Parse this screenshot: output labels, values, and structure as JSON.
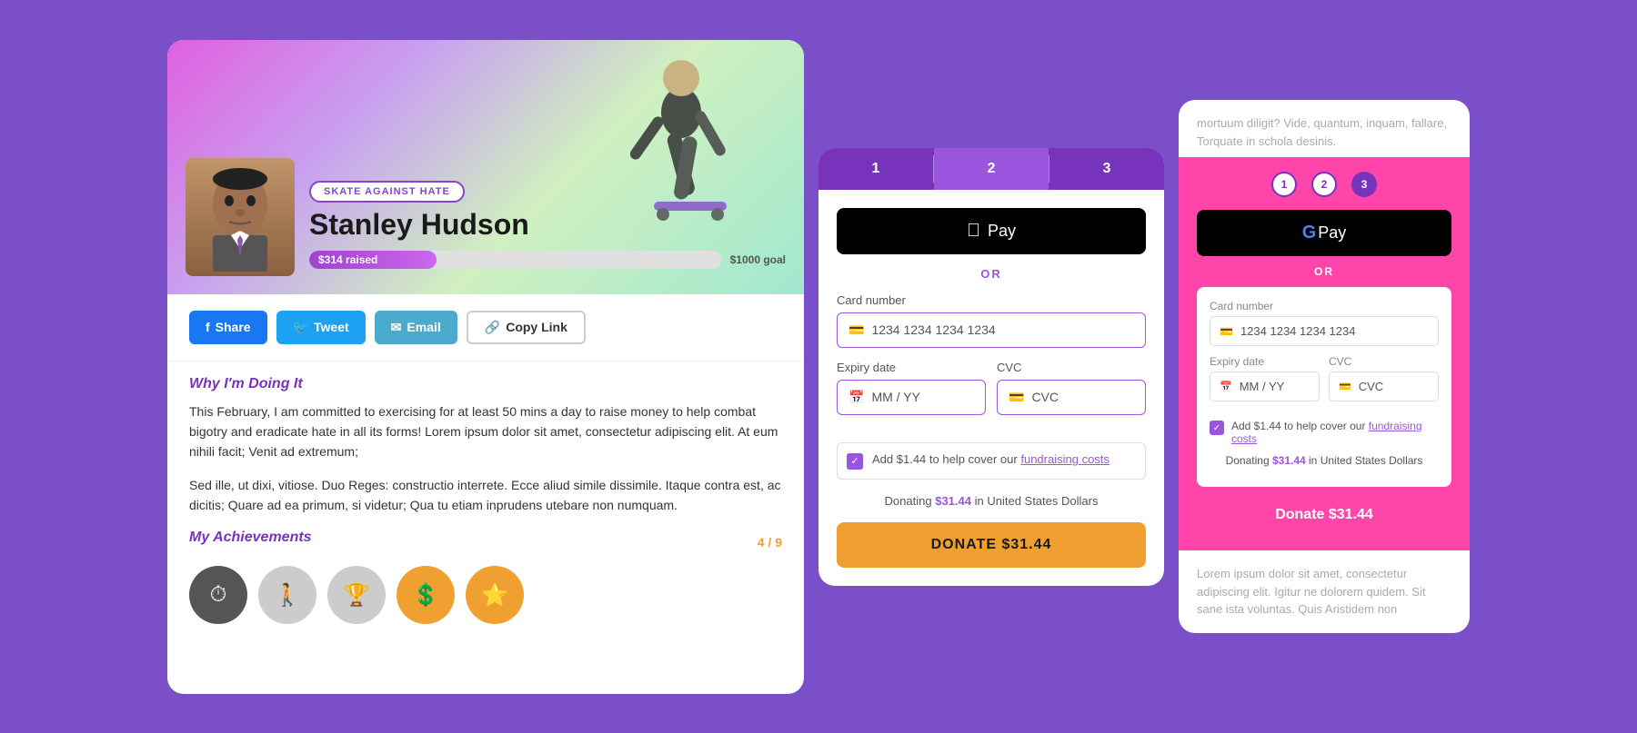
{
  "leftCard": {
    "campaignBadge": "Skate Against Hate",
    "profileName": "Stanley Hudson",
    "raisedAmount": "$314 raised",
    "goalAmount": "$1000 goal",
    "progressPercent": 31,
    "shareButtons": [
      {
        "label": "Share",
        "type": "facebook"
      },
      {
        "label": "Tweet",
        "type": "twitter"
      },
      {
        "label": "Email",
        "type": "email"
      },
      {
        "label": "Copy Link",
        "type": "copylink"
      }
    ],
    "whyTitle": "Why I'm Doing It",
    "whyText1": "This February, I am committed to exercising for at least 50 mins a day to raise money to help combat bigotry and eradicate hate in all its forms! Lorem ipsum dolor sit amet, consectetur adipiscing elit. At eum nihili facit; Venit ad extremum;",
    "whyText2": "Sed ille, ut dixi, vitiose. Duo Reges: constructio interrete. Ecce aliud simile dissimile. Itaque contra est, ac dicitis; Quare ad ea primum, si videtur; Qua tu etiam inprudens utebare non numquam.",
    "achievementsTitle": "My Achievements",
    "achievementsCount": "4 / 9"
  },
  "middleCard": {
    "steps": [
      "1",
      "2",
      "3"
    ],
    "activeStep": 1,
    "applePayLabel": " Pay",
    "orLabel": "OR",
    "cardNumberLabel": "Card number",
    "cardNumberValue": "1234 1234 1234 1234",
    "cardNumberPlaceholder": "1234 1234 1234 1234",
    "expiryLabel": "Expiry date",
    "expiryPlaceholder": "MM / YY",
    "cvcLabel": "CVC",
    "cvcPlaceholder": "CVC",
    "checkboxText": "Add $1.44 to help cover our",
    "checkboxLink": "fundraising costs",
    "donatingText": "Donating",
    "donatingAmount": "$31.44",
    "donatingCurrency": "in United States Dollars",
    "donateButtonLabel": "DONATE $31.44"
  },
  "rightCard": {
    "topText": "mortuum diligit? Vide, quantum, inquam, fallare, Torquate in schola desinis.",
    "stepLabels": [
      "1",
      "2",
      "3"
    ],
    "activeStep": 2,
    "gPayLabel": "Pay",
    "orLabel": "OR",
    "cardNumberLabel": "Card number",
    "cardNumberValue": "1234 1234 1234 1234",
    "expiryLabel": "Expiry date",
    "expiryPlaceholder": "MM / YY",
    "cvcLabel": "CVC",
    "cvcPlaceholder": "CVC",
    "checkboxText": "Add $1.44 to help cover our",
    "checkboxLink": "fundraising costs",
    "donatingText": "Donating",
    "donatingAmount": "$31.44",
    "donatingCurrency": "in United States Dollars",
    "donateButtonLabel": "Donate $31.44",
    "bottomText": "Lorem ipsum dolor sit amet, consectetur adipiscing elit. Igitur ne dolorem quidem. Sit sane ista voluntas. Quis Aristidem non"
  }
}
